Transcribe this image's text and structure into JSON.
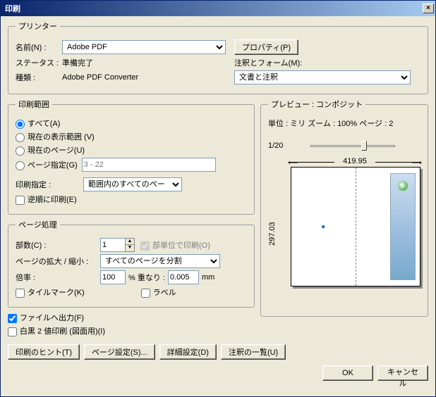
{
  "title": "印刷",
  "printer": {
    "legend": "プリンター",
    "name_label": "名前(N) :",
    "name_value": "Adobe PDF",
    "properties_btn": "プロパティ(P)",
    "status_label": "ステータス :",
    "status_value": "準備完了",
    "comment_form_label": "注釈とフォーム(M):",
    "type_label": "種類 :",
    "type_value": "Adobe PDF Converter",
    "comment_form_value": "文書と注釈"
  },
  "range": {
    "legend": "印刷範囲",
    "all": "すべて(A)",
    "current_view": "現在の表示範囲 (V)",
    "current_page": "現在のページ(U)",
    "pages": "ページ指定(G)",
    "pages_placeholder": "3 - 22",
    "subset_label": "印刷指定 :",
    "subset_value": "範囲内のすべてのペー",
    "reverse": "逆順に印刷(E)"
  },
  "handling": {
    "legend": "ページ処理",
    "copies_label": "部数(C) :",
    "copies_value": "1",
    "collate": "部単位で印刷(O)",
    "scaling_label": "ページの拡大 / 縮小 :",
    "scaling_value": "すべてのページを分割",
    "zoom_label": "倍率 :",
    "zoom_value": "100",
    "overlap_label": "% 重なり :",
    "overlap_value": "0.005",
    "overlap_unit": "mm",
    "tilemark": "タイルマーク(K)",
    "label": "ラベル"
  },
  "options": {
    "to_file": "ファイルへ出力(F)",
    "bw": "白黒 2 値印刷 (図面用)(I)"
  },
  "preview": {
    "legend": "プレビュー : コンポジット",
    "units_line": "単位 : ミリ ズーム : 100% ページ : 2",
    "fraction": "1/20",
    "width": "419.95",
    "height": "297.03"
  },
  "footer": {
    "hints": "印刷のヒント(T)",
    "page_setup": "ページ設定(S)...",
    "advanced": "詳細設定(D)",
    "comments": "注釈の一覧(U)",
    "ok": "OK",
    "cancel": "キャンセル"
  }
}
